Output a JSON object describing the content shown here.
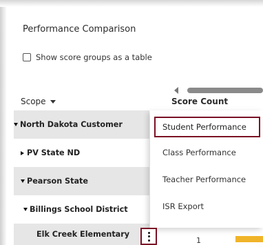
{
  "panel": {
    "title": "Performance Comparison",
    "checkbox_label": "Show score groups as a table"
  },
  "table": {
    "headers": {
      "scope": "Scope",
      "score_count": "Score Count"
    },
    "rows": [
      {
        "label": "North Dakota Customer"
      },
      {
        "label": "PV State ND"
      },
      {
        "label": "Pearson State"
      },
      {
        "label": "Billings School District"
      },
      {
        "label": "Elk Creek Elementary",
        "score_count": "1"
      }
    ]
  },
  "context_menu": {
    "items": [
      {
        "label": "Student Performance"
      },
      {
        "label": "Class Performance"
      },
      {
        "label": "Teacher Performance"
      },
      {
        "label": "ISR Export"
      }
    ]
  },
  "colors": {
    "highlight_border": "#7a1024",
    "bar": "#f0b429",
    "row_shade": "#e6e6e6"
  }
}
